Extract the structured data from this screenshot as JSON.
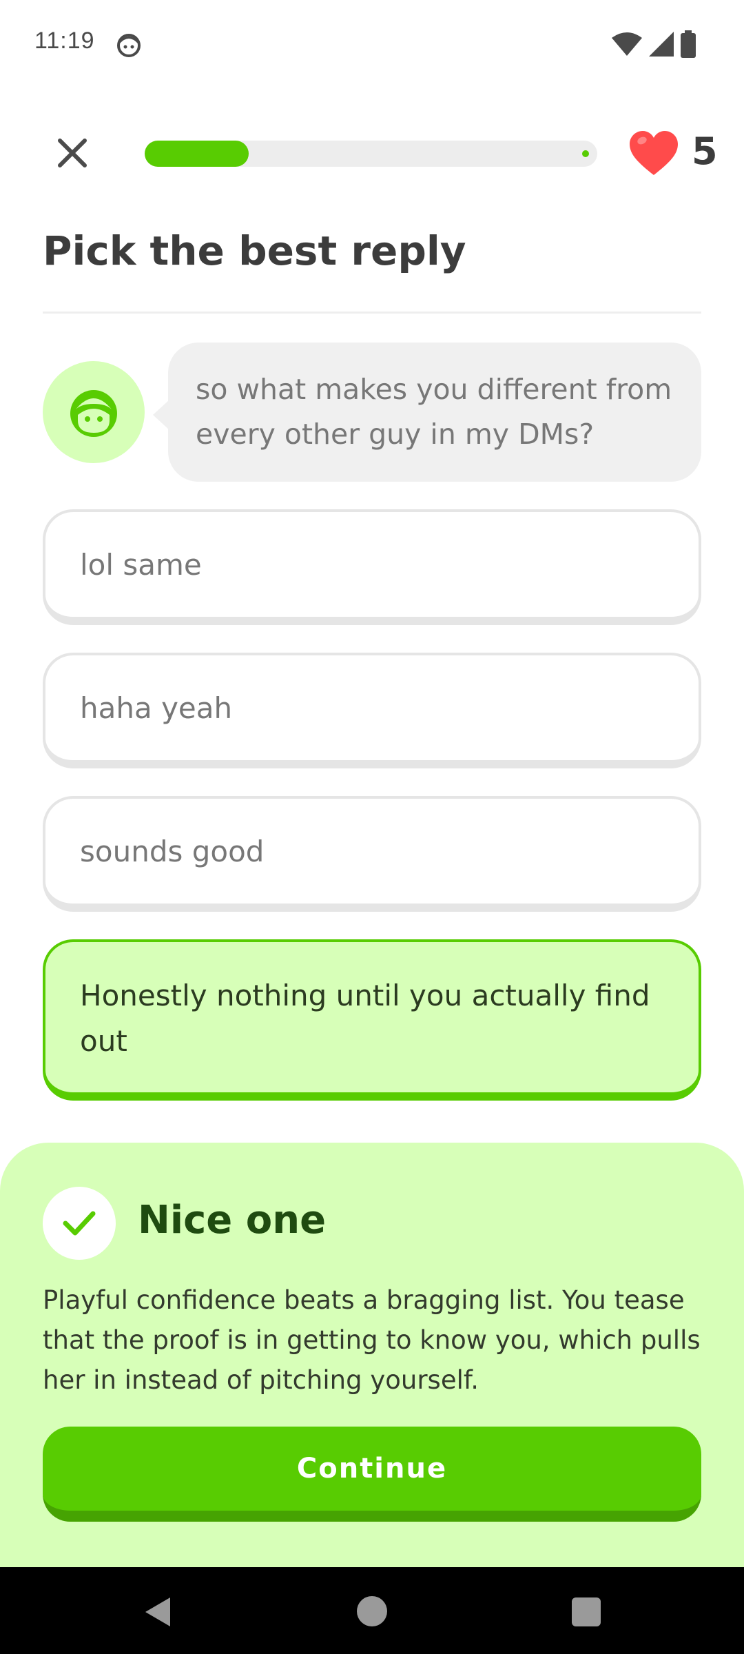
{
  "status_bar": {
    "time": "11:19"
  },
  "header": {
    "progress_fraction": 0.23,
    "hearts_count": "5"
  },
  "prompt": {
    "title": "Pick the best reply"
  },
  "chat": {
    "message": "so what makes you different from every other guy in my DMs?"
  },
  "options": [
    {
      "label": "lol same"
    },
    {
      "label": "haha yeah"
    },
    {
      "label": "sounds good"
    },
    {
      "label": "Honestly nothing until you actually find out",
      "state": "correct"
    }
  ],
  "feedback": {
    "title": "Nice one",
    "text": "Playful confidence beats a bragging list. You tease that the proof is in getting to know you, which pulls her in instead of pitching yourself.",
    "continue_label": "Continue"
  },
  "colors": {
    "accent_green": "#58cc02",
    "light_green": "#d7ffb8",
    "heart_red": "#ff4b4b"
  },
  "icons": {
    "close": "close-icon",
    "heart": "heart-icon",
    "check": "check-icon",
    "avatar": "character-avatar-icon"
  }
}
